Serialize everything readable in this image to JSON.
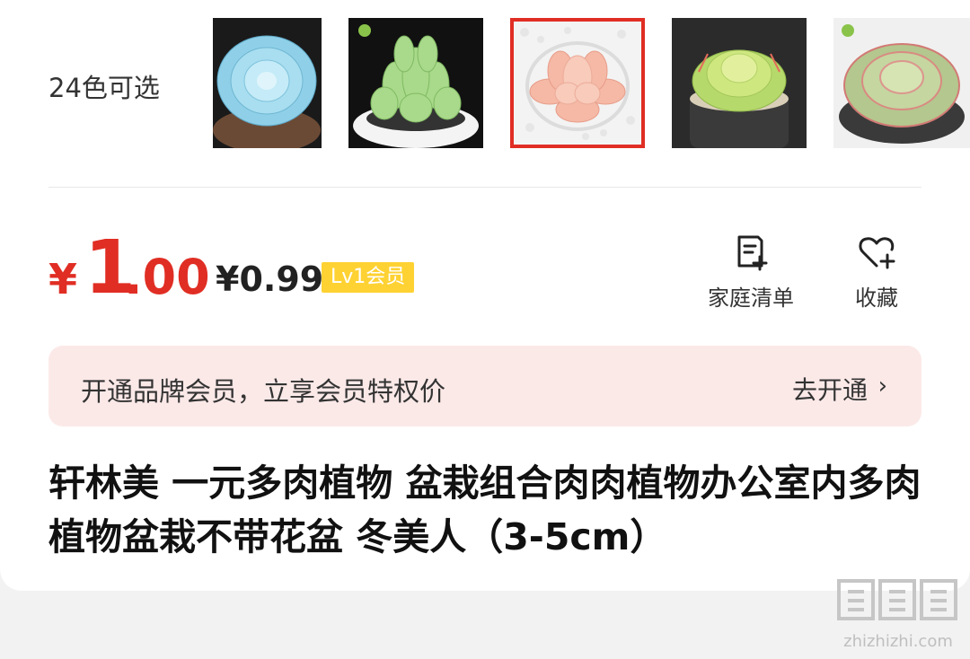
{
  "variants": {
    "count_label": "24色可选",
    "selected_index": 2
  },
  "price": {
    "currency": "¥",
    "integer": "1",
    "decimal": ".00",
    "member_price": "¥0.99",
    "member_badge": "Lv1会员"
  },
  "actions": {
    "family_list": "家庭清单",
    "favorite": "收藏"
  },
  "promo": {
    "text": "开通品牌会员，立享会员特权价",
    "link": "去开通",
    "chevron": "›"
  },
  "product": {
    "title": "轩林美 一元多肉植物 盆栽组合肉肉植物办公室内多肉植物盆栽不带花盆 冬美人（3-5cm）"
  },
  "watermark": {
    "logo": "值|值|值",
    "url": "zhizhizhi.com"
  },
  "colors": {
    "accent": "#e02e24",
    "badge": "#ffd233",
    "promo_bg": "#fbe9e8"
  }
}
